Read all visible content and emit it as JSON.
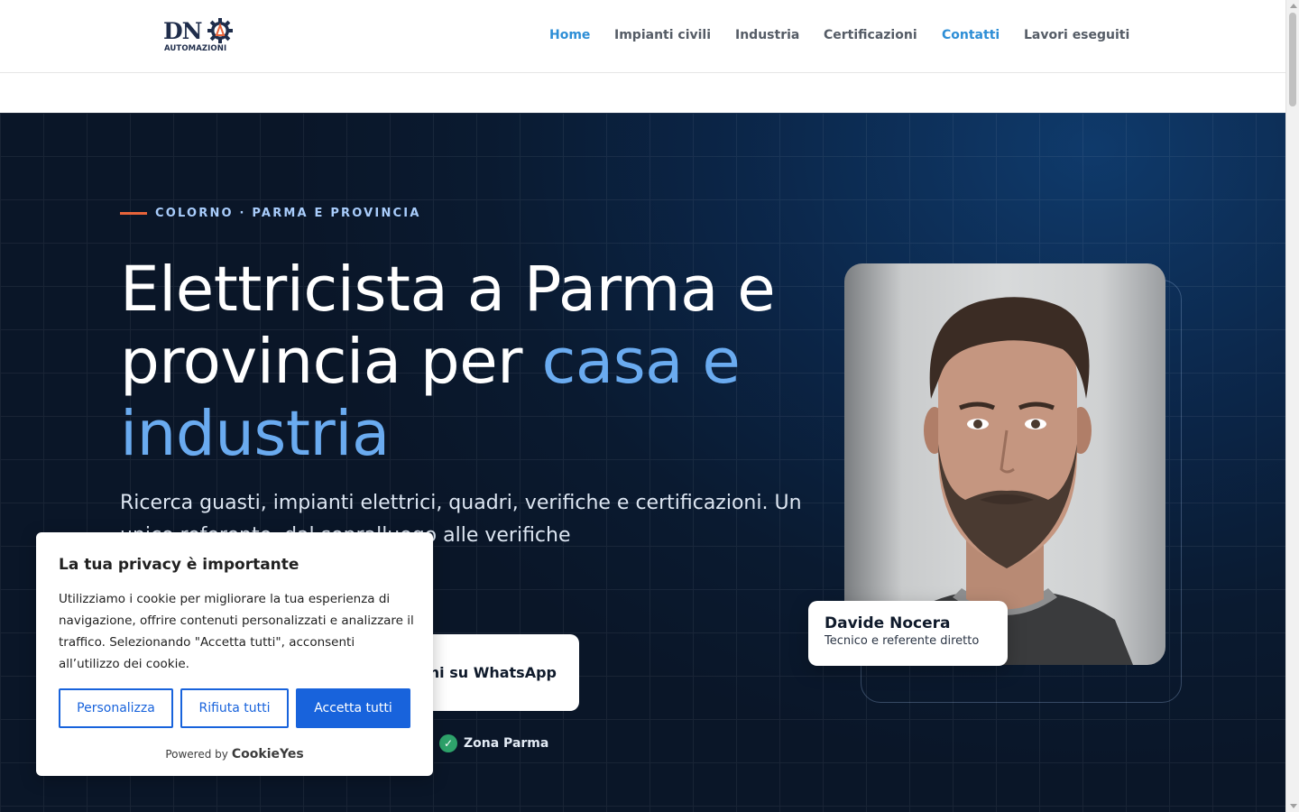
{
  "header": {
    "logo": {
      "primary": "DN",
      "secondary": "AUTOMAZIONI"
    },
    "nav": [
      {
        "label": "Home",
        "active": true
      },
      {
        "label": "Impianti civili",
        "active": false
      },
      {
        "label": "Industria",
        "active": false
      },
      {
        "label": "Certificazioni",
        "active": false
      },
      {
        "label": "Contatti",
        "active": true
      },
      {
        "label": "Lavori eseguiti",
        "active": false
      }
    ]
  },
  "hero": {
    "eyebrow": "COLORNO · PARMA E PROVINCIA",
    "title_part1": "Elettricista a Parma e provincia per ",
    "title_accent": "casa e industria",
    "subtitle": "Ricerca guasti, impianti elettrici, quadri, verifiche e certificazioni. Un unico referente, dal sopralluogo alle verifiche",
    "whatsapp_button": "ni su WhatsApp",
    "zone_badge": "Zona Parma",
    "person": {
      "name": "Davide Nocera",
      "role": "Tecnico e referente diretto"
    }
  },
  "cookie_banner": {
    "title": "La tua privacy è importante",
    "text": "Utilizziamo i cookie per migliorare la tua esperienza di navigazione, offrire contenuti personalizzati e analizzare il traffico. Selezionando \"Accetta tutti\", acconsenti all’utilizzo dei cookie.",
    "buttons": {
      "customize": "Personalizza",
      "reject": "Rifiuta tutti",
      "accept": "Accetta tutti"
    },
    "powered_by": "Powered by",
    "brand": "CookieYes"
  },
  "colors": {
    "nav_active": "#2d8ed6",
    "hero_background": "#0b2547",
    "accent_text": "#6aabf0",
    "eyebrow_line": "#e8643a",
    "cookie_primary": "#1863dc",
    "check_badge": "#2ea36b"
  }
}
